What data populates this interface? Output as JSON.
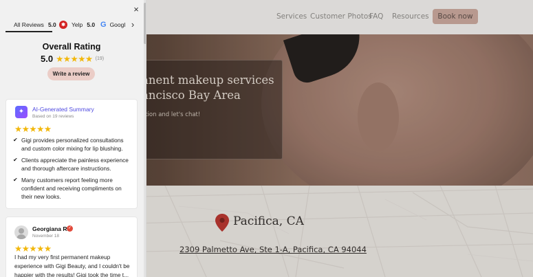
{
  "site": {
    "nav": {
      "links": [
        "Services",
        "Customer Photos",
        "FAQ",
        "Resources"
      ],
      "book_button": "Book now"
    },
    "hero": {
      "title_line1": "anent makeup services",
      "title_line2": "ancisco Bay Area",
      "subtitle": "ation and let's chat!"
    },
    "location": {
      "city": "Pacifica, CA",
      "address": "2309 Palmetto Ave, Ste 1-A, Pacifica, CA 94044"
    }
  },
  "reviews_panel": {
    "close_icon": "×",
    "tabs": [
      {
        "label": "All Reviews",
        "score": "5.0"
      },
      {
        "label": "Yelp",
        "score": "5.0"
      },
      {
        "label": "Googl",
        "score": ""
      }
    ],
    "tab_next_icon": "›",
    "overall": {
      "title": "Overall Rating",
      "score": "5.0",
      "stars": "★★★★★",
      "count": "(19)",
      "write_button": "Write a review"
    },
    "ai_summary": {
      "icon": "✦",
      "title": "AI-Generated Summary",
      "subtitle": "Based on 19 reviews",
      "stars": "★★★★★",
      "points": [
        "Gigi provides personalized consultations and custom color mixing for lip blushing.",
        "Clients appreciate the painless experience and thorough aftercare instructions.",
        "Many customers report feeling more confident and receiving compliments on their new looks."
      ]
    },
    "review": {
      "name": "Georgiana R.",
      "date": "November 18",
      "stars": "★★★★★",
      "text": "I had my very first permanent makeup experience with Gigi Beauty, and I couldn't be happier with the results! Gigi took the time t..."
    }
  },
  "colors": {
    "accent": "#ebcdc7",
    "star": "#f2b70a",
    "ai_title": "#4f4ae0",
    "book_button": "#caa79c"
  }
}
